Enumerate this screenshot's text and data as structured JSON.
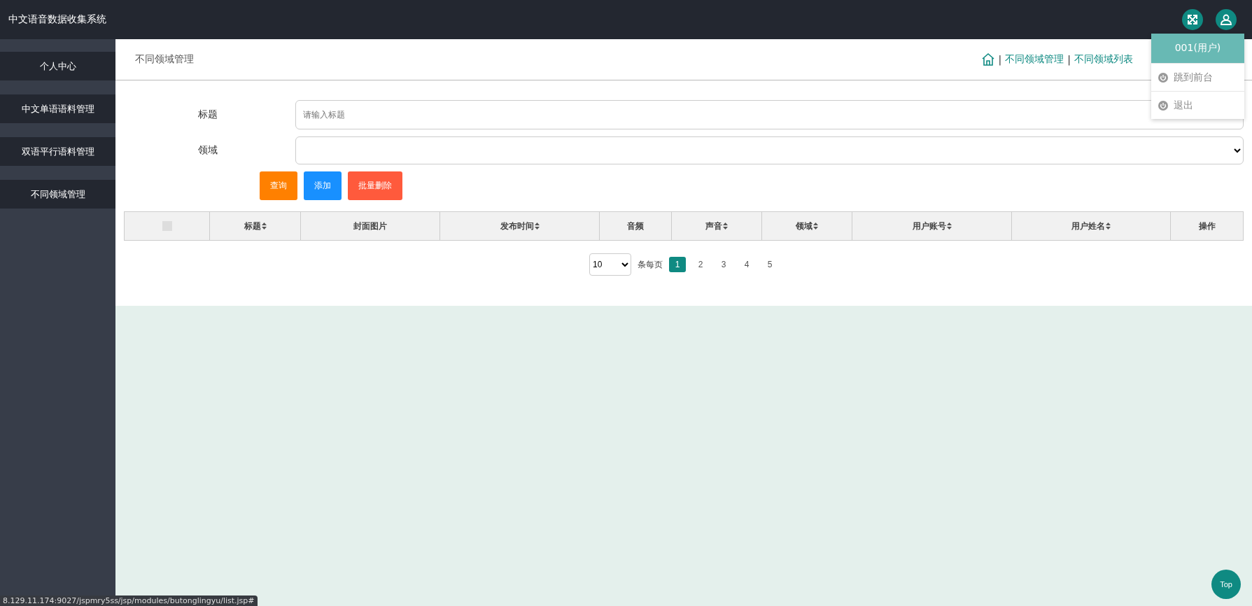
{
  "header": {
    "title": "中文语音数据收集系统"
  },
  "sidebar": {
    "items": [
      {
        "label": "个人中心",
        "selected": false
      },
      {
        "label": "中文单语语料管理",
        "selected": false
      },
      {
        "label": "双语平行语料管理",
        "selected": false
      },
      {
        "label": "不同领域管理",
        "selected": false
      }
    ]
  },
  "page_title": "不同领域管理",
  "breadcrumb": {
    "separator": "|",
    "items": [
      "不同领域管理",
      "不同领域列表"
    ]
  },
  "user_menu": {
    "user": "001(用户)",
    "items": [
      "跳到前台",
      "退出"
    ]
  },
  "form": {
    "fields": [
      {
        "label": "标题",
        "kind": "text",
        "placeholder": "请输入标题"
      },
      {
        "label": "领域",
        "kind": "select"
      }
    ],
    "buttons": [
      {
        "label": "查询",
        "color": "#ff8000"
      },
      {
        "label": "添加",
        "color": "#1890ff"
      },
      {
        "label": "批量删除",
        "color": "#ff5a3c"
      }
    ]
  },
  "table": {
    "columns": [
      {
        "kind": "checkbox",
        "checked": false
      },
      {
        "label": "标题",
        "sortable": true
      },
      {
        "label": "封面图片",
        "sortable": false
      },
      {
        "label": "发布时间",
        "sortable": true
      },
      {
        "label": "音频",
        "sortable": false
      },
      {
        "label": "声音",
        "sortable": true
      },
      {
        "label": "领域",
        "sortable": true
      },
      {
        "label": "用户账号",
        "sortable": true
      },
      {
        "label": "用户姓名",
        "sortable": true
      },
      {
        "label": "操作",
        "sortable": false
      }
    ]
  },
  "pagination": {
    "page_size": "10",
    "per_page_label": "条每页",
    "pages": [
      {
        "label": "1",
        "selected": true
      },
      {
        "label": "2",
        "selected": false
      },
      {
        "label": "3",
        "selected": false
      },
      {
        "label": "4",
        "selected": false
      },
      {
        "label": "5",
        "selected": false
      }
    ]
  },
  "top_button": "Top",
  "status_url": "8.129.11.174:9027/jspmry5ss/jsp/modules/butonglingyu/list.jsp#"
}
